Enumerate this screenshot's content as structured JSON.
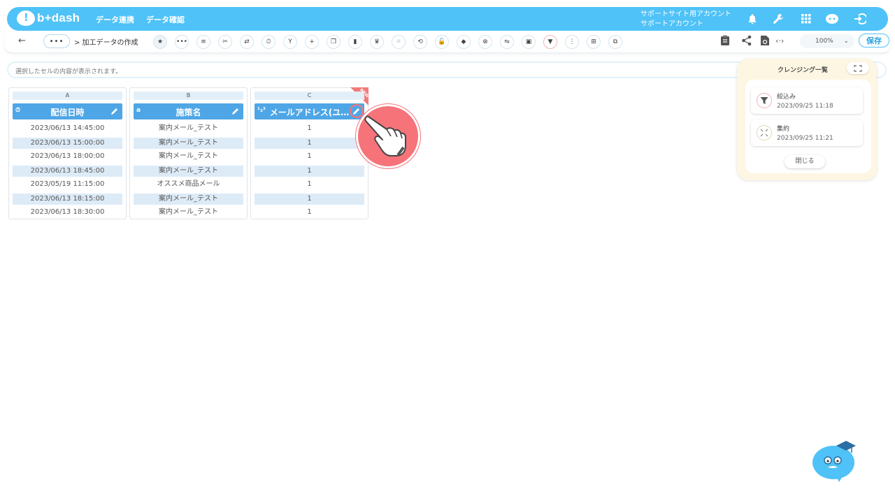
{
  "header": {
    "logo_text": "b+dash",
    "nav": [
      "データ連携",
      "データ確認"
    ],
    "account_line1": "サポートサイト用アカウント",
    "account_line2": "サポートアカウント"
  },
  "toolbar": {
    "back_glyph": "←",
    "more_glyph": "•••",
    "breadcrumb": "> 加工データの作成",
    "zoom": "100%",
    "save_label": "保存"
  },
  "cell_bar": {
    "placeholder": "選択したセルの内容が表示されます。"
  },
  "columns": [
    {
      "letter": "A",
      "type_glyph": "⏱",
      "name": "配信日時",
      "rows": [
        "2023/06/13 14:45:00",
        "2023/06/13 15:00:00",
        "2023/06/13 18:00:00",
        "2023/06/13 18:45:00",
        "2023/05/19 11:15:00",
        "2023/06/13 18:15:00",
        "2023/06/13 18:30:00"
      ]
    },
    {
      "letter": "B",
      "type_glyph": "a",
      "name": "施策名",
      "rows": [
        "案内メール_テスト",
        "案内メール_テスト",
        "案内メール_テスト",
        "案内メール_テスト",
        "オススメ商品メール",
        "案内メール_テスト",
        "案内メール_テスト"
      ]
    },
    {
      "letter": "C",
      "type_glyph": "¹₂³",
      "name": "メールアドレス(ユ…",
      "badge": "NEW",
      "rows": [
        "1",
        "1",
        "1",
        "1",
        "1",
        "1",
        "1"
      ]
    }
  ],
  "cleansing": {
    "title": "クレンジング一覧",
    "items": [
      {
        "name": "絞込み",
        "date": "2023/09/25 11:18",
        "icon": "filter-icon"
      },
      {
        "name": "集約",
        "date": "2023/09/25 11:21",
        "icon": "aggregate-icon"
      }
    ],
    "close_label": "閉じる"
  },
  "colors": {
    "header_bg": "#4fc2f7",
    "column_header": "#4ea6e6",
    "row_alt": "#ddebf7",
    "panel_bg": "#fdf6e2",
    "pointer": "#f6737a"
  }
}
